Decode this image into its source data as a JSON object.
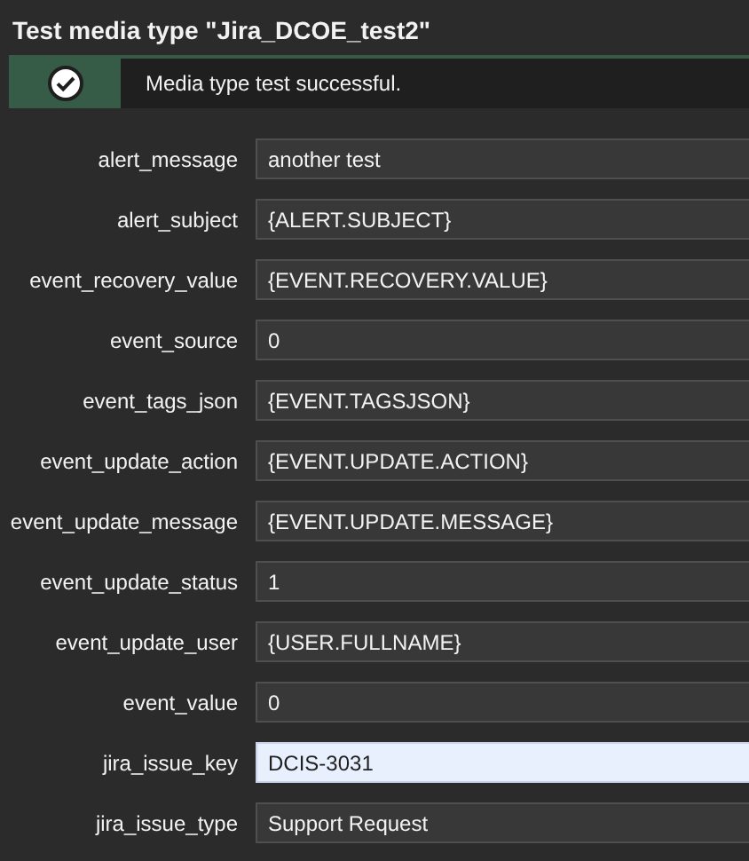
{
  "title": "Test media type \"Jira_DCOE_test2\"",
  "message": {
    "kind": "success",
    "text": "Media type test successful."
  },
  "fields": [
    {
      "label": "alert_message",
      "value": "another test",
      "highlighted": false
    },
    {
      "label": "alert_subject",
      "value": "{ALERT.SUBJECT}",
      "highlighted": false
    },
    {
      "label": "event_recovery_value",
      "value": "{EVENT.RECOVERY.VALUE}",
      "highlighted": false
    },
    {
      "label": "event_source",
      "value": "0",
      "highlighted": false
    },
    {
      "label": "event_tags_json",
      "value": "{EVENT.TAGSJSON}",
      "highlighted": false
    },
    {
      "label": "event_update_action",
      "value": "{EVENT.UPDATE.ACTION}",
      "highlighted": false
    },
    {
      "label": "event_update_message",
      "value": "{EVENT.UPDATE.MESSAGE}",
      "highlighted": false
    },
    {
      "label": "event_update_status",
      "value": "1",
      "highlighted": false
    },
    {
      "label": "event_update_user",
      "value": "{USER.FULLNAME}",
      "highlighted": false
    },
    {
      "label": "event_value",
      "value": "0",
      "highlighted": false
    },
    {
      "label": "jira_issue_key",
      "value": "DCIS-3031",
      "highlighted": true
    },
    {
      "label": "jira_issue_type",
      "value": "Support Request",
      "highlighted": false
    }
  ]
}
